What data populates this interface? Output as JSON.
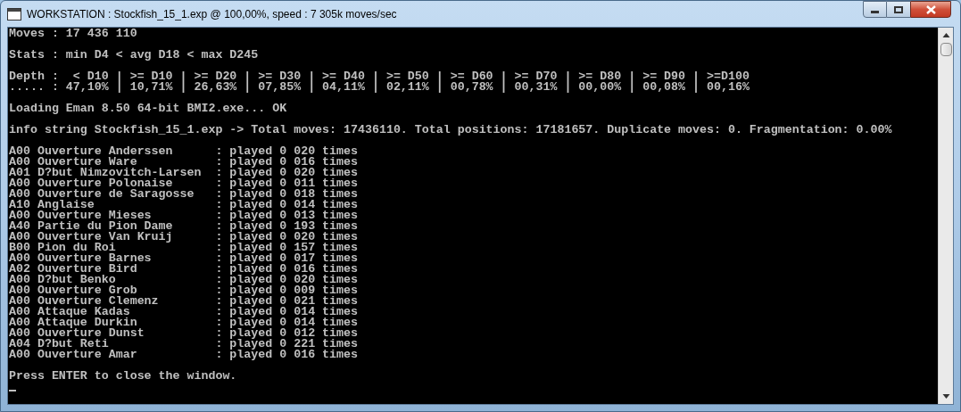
{
  "window": {
    "title": "WORKSTATION : Stockfish_15_1.exp @ 100,00%, speed : 7 305k moves/sec"
  },
  "console": {
    "blocks": [
      [
        "Moves : 17 436 110"
      ],
      [
        "Stats : min D4 < avg D18 < max D245"
      ],
      [
        "Depth :  < D10 | >= D10 | >= D20 | >= D30 | >= D40 | >= D50 | >= D60 | >= D70 | >= D80 | >= D90 | >=D100",
        "..... : 47,10% | 10,71% | 26,63% | 07,85% | 04,11% | 02,11% | 00,78% | 00,31% | 00,00% | 00,08% | 00,16%"
      ],
      [
        "Loading Eman 8.50 64-bit BMI2.exe... OK"
      ],
      [
        "info string Stockfish_15_1.exp -> Total moves: 17436110. Total positions: 17181657. Duplicate moves: 0. Fragmentation: 0.00%"
      ],
      [
        "A00 Ouverture Anderssen      : played 0 020 times",
        "A00 Ouverture Ware           : played 0 016 times",
        "A01 D?but Nimzovitch-Larsen  : played 0 020 times",
        "A00 Ouverture Polonaise      : played 0 011 times",
        "A00 Ouverture de Saragosse   : played 0 018 times",
        "A10 Anglaise                 : played 0 014 times",
        "A00 Ouverture Mieses         : played 0 013 times",
        "A40 Partie du Pion Dame      : played 0 193 times",
        "A00 Ouverture Van Kruij      : played 0 020 times",
        "B00 Pion du Roi              : played 0 157 times",
        "A00 Ouverture Barnes         : played 0 017 times",
        "A02 Ouverture Bird           : played 0 016 times",
        "A00 D?but Benko              : played 0 020 times",
        "A00 Ouverture Grob           : played 0 009 times",
        "A00 Ouverture Clemenz        : played 0 021 times",
        "A00 Attaque Kadas            : played 0 014 times",
        "A00 Attaque Durkin           : played 0 014 times",
        "A00 Ouverture Dunst          : played 0 012 times",
        "A04 D?but Reti               : played 0 221 times",
        "A00 Ouverture Amar           : played 0 016 times"
      ],
      [
        "Press ENTER to close the window."
      ]
    ],
    "cursor_visible": true
  }
}
